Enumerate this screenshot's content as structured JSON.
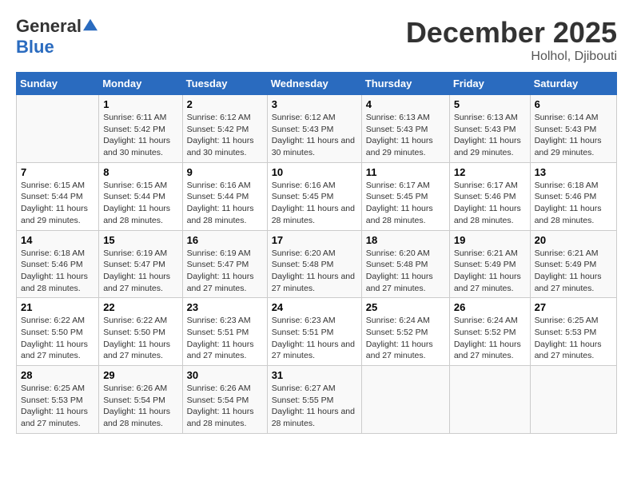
{
  "header": {
    "logo_general": "General",
    "logo_blue": "Blue",
    "month": "December 2025",
    "location": "Holhol, Djibouti"
  },
  "days_of_week": [
    "Sunday",
    "Monday",
    "Tuesday",
    "Wednesday",
    "Thursday",
    "Friday",
    "Saturday"
  ],
  "weeks": [
    [
      {
        "day": "",
        "sunrise": "",
        "sunset": "",
        "daylight": ""
      },
      {
        "day": "1",
        "sunrise": "Sunrise: 6:11 AM",
        "sunset": "Sunset: 5:42 PM",
        "daylight": "Daylight: 11 hours and 30 minutes."
      },
      {
        "day": "2",
        "sunrise": "Sunrise: 6:12 AM",
        "sunset": "Sunset: 5:42 PM",
        "daylight": "Daylight: 11 hours and 30 minutes."
      },
      {
        "day": "3",
        "sunrise": "Sunrise: 6:12 AM",
        "sunset": "Sunset: 5:43 PM",
        "daylight": "Daylight: 11 hours and 30 minutes."
      },
      {
        "day": "4",
        "sunrise": "Sunrise: 6:13 AM",
        "sunset": "Sunset: 5:43 PM",
        "daylight": "Daylight: 11 hours and 29 minutes."
      },
      {
        "day": "5",
        "sunrise": "Sunrise: 6:13 AM",
        "sunset": "Sunset: 5:43 PM",
        "daylight": "Daylight: 11 hours and 29 minutes."
      },
      {
        "day": "6",
        "sunrise": "Sunrise: 6:14 AM",
        "sunset": "Sunset: 5:43 PM",
        "daylight": "Daylight: 11 hours and 29 minutes."
      }
    ],
    [
      {
        "day": "7",
        "sunrise": "Sunrise: 6:15 AM",
        "sunset": "Sunset: 5:44 PM",
        "daylight": "Daylight: 11 hours and 29 minutes."
      },
      {
        "day": "8",
        "sunrise": "Sunrise: 6:15 AM",
        "sunset": "Sunset: 5:44 PM",
        "daylight": "Daylight: 11 hours and 28 minutes."
      },
      {
        "day": "9",
        "sunrise": "Sunrise: 6:16 AM",
        "sunset": "Sunset: 5:44 PM",
        "daylight": "Daylight: 11 hours and 28 minutes."
      },
      {
        "day": "10",
        "sunrise": "Sunrise: 6:16 AM",
        "sunset": "Sunset: 5:45 PM",
        "daylight": "Daylight: 11 hours and 28 minutes."
      },
      {
        "day": "11",
        "sunrise": "Sunrise: 6:17 AM",
        "sunset": "Sunset: 5:45 PM",
        "daylight": "Daylight: 11 hours and 28 minutes."
      },
      {
        "day": "12",
        "sunrise": "Sunrise: 6:17 AM",
        "sunset": "Sunset: 5:46 PM",
        "daylight": "Daylight: 11 hours and 28 minutes."
      },
      {
        "day": "13",
        "sunrise": "Sunrise: 6:18 AM",
        "sunset": "Sunset: 5:46 PM",
        "daylight": "Daylight: 11 hours and 28 minutes."
      }
    ],
    [
      {
        "day": "14",
        "sunrise": "Sunrise: 6:18 AM",
        "sunset": "Sunset: 5:46 PM",
        "daylight": "Daylight: 11 hours and 28 minutes."
      },
      {
        "day": "15",
        "sunrise": "Sunrise: 6:19 AM",
        "sunset": "Sunset: 5:47 PM",
        "daylight": "Daylight: 11 hours and 27 minutes."
      },
      {
        "day": "16",
        "sunrise": "Sunrise: 6:19 AM",
        "sunset": "Sunset: 5:47 PM",
        "daylight": "Daylight: 11 hours and 27 minutes."
      },
      {
        "day": "17",
        "sunrise": "Sunrise: 6:20 AM",
        "sunset": "Sunset: 5:48 PM",
        "daylight": "Daylight: 11 hours and 27 minutes."
      },
      {
        "day": "18",
        "sunrise": "Sunrise: 6:20 AM",
        "sunset": "Sunset: 5:48 PM",
        "daylight": "Daylight: 11 hours and 27 minutes."
      },
      {
        "day": "19",
        "sunrise": "Sunrise: 6:21 AM",
        "sunset": "Sunset: 5:49 PM",
        "daylight": "Daylight: 11 hours and 27 minutes."
      },
      {
        "day": "20",
        "sunrise": "Sunrise: 6:21 AM",
        "sunset": "Sunset: 5:49 PM",
        "daylight": "Daylight: 11 hours and 27 minutes."
      }
    ],
    [
      {
        "day": "21",
        "sunrise": "Sunrise: 6:22 AM",
        "sunset": "Sunset: 5:50 PM",
        "daylight": "Daylight: 11 hours and 27 minutes."
      },
      {
        "day": "22",
        "sunrise": "Sunrise: 6:22 AM",
        "sunset": "Sunset: 5:50 PM",
        "daylight": "Daylight: 11 hours and 27 minutes."
      },
      {
        "day": "23",
        "sunrise": "Sunrise: 6:23 AM",
        "sunset": "Sunset: 5:51 PM",
        "daylight": "Daylight: 11 hours and 27 minutes."
      },
      {
        "day": "24",
        "sunrise": "Sunrise: 6:23 AM",
        "sunset": "Sunset: 5:51 PM",
        "daylight": "Daylight: 11 hours and 27 minutes."
      },
      {
        "day": "25",
        "sunrise": "Sunrise: 6:24 AM",
        "sunset": "Sunset: 5:52 PM",
        "daylight": "Daylight: 11 hours and 27 minutes."
      },
      {
        "day": "26",
        "sunrise": "Sunrise: 6:24 AM",
        "sunset": "Sunset: 5:52 PM",
        "daylight": "Daylight: 11 hours and 27 minutes."
      },
      {
        "day": "27",
        "sunrise": "Sunrise: 6:25 AM",
        "sunset": "Sunset: 5:53 PM",
        "daylight": "Daylight: 11 hours and 27 minutes."
      }
    ],
    [
      {
        "day": "28",
        "sunrise": "Sunrise: 6:25 AM",
        "sunset": "Sunset: 5:53 PM",
        "daylight": "Daylight: 11 hours and 27 minutes."
      },
      {
        "day": "29",
        "sunrise": "Sunrise: 6:26 AM",
        "sunset": "Sunset: 5:54 PM",
        "daylight": "Daylight: 11 hours and 28 minutes."
      },
      {
        "day": "30",
        "sunrise": "Sunrise: 6:26 AM",
        "sunset": "Sunset: 5:54 PM",
        "daylight": "Daylight: 11 hours and 28 minutes."
      },
      {
        "day": "31",
        "sunrise": "Sunrise: 6:27 AM",
        "sunset": "Sunset: 5:55 PM",
        "daylight": "Daylight: 11 hours and 28 minutes."
      },
      {
        "day": "",
        "sunrise": "",
        "sunset": "",
        "daylight": ""
      },
      {
        "day": "",
        "sunrise": "",
        "sunset": "",
        "daylight": ""
      },
      {
        "day": "",
        "sunrise": "",
        "sunset": "",
        "daylight": ""
      }
    ]
  ]
}
